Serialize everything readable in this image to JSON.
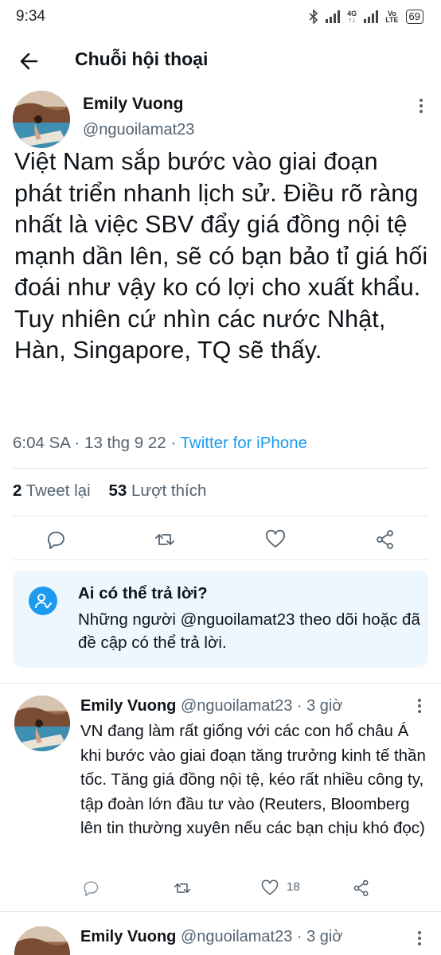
{
  "status_bar": {
    "time": "9:34",
    "network_top": "4G",
    "network_bottom": "VoLTE",
    "battery": "69"
  },
  "header": {
    "title": "Chuỗi hội thoại"
  },
  "main_tweet": {
    "author_name": "Emily Vuong",
    "author_handle": "@nguoilamat23",
    "text": "Việt Nam sắp bước vào giai đoạn phát triển nhanh lịch sử. Điều rõ ràng nhất là việc SBV đẩy giá đồng nội tệ mạnh dần lên, sẽ có bạn bảo tỉ giá hối đoái như vậy ko có lợi cho xuất khẩu. Tuy nhiên cứ nhìn các nước Nhật, Hàn, Singapore, TQ sẽ thấy.",
    "time": "6:04 SA",
    "date": "13 thg 9 22",
    "source": "Twitter for iPhone",
    "retweets": "2",
    "retweets_label": "Tweet lại",
    "likes": "53",
    "likes_label": "Lượt thích"
  },
  "reply_info": {
    "title": "Ai có thể trả lời?",
    "description": "Những người @nguoilamat23 theo dõi hoặc đã đề cập có thể trả lời."
  },
  "replies": [
    {
      "author_name": "Emily Vuong",
      "author_handle": "@nguoilamat23",
      "time_ago": "3 giờ",
      "text": "VN đang làm rất giống với các con hổ châu Á khi bước vào giai đoạn tăng trưởng kinh tế thần tốc. Tăng giá đồng nội tệ, kéo rất nhiều công ty, tập đoàn lớn đầu tư vào (Reuters, Bloomberg lên tin thường xuyên nếu các bạn chịu khó đọc)",
      "likes": "18"
    },
    {
      "author_name": "Emily Vuong",
      "author_handle": "@nguoilamat23",
      "time_ago": "3 giờ"
    }
  ],
  "icons": {
    "back": "arrow-left-icon",
    "more": "more-vertical-icon",
    "reply": "comment-icon",
    "retweet": "retweet-icon",
    "like": "heart-icon",
    "share": "share-icon",
    "reply_permission": "user-check-icon"
  },
  "colors": {
    "accent": "#1d9bf0",
    "text": "#0f1419",
    "secondary": "#536471",
    "card_bg": "#eef7fd"
  }
}
